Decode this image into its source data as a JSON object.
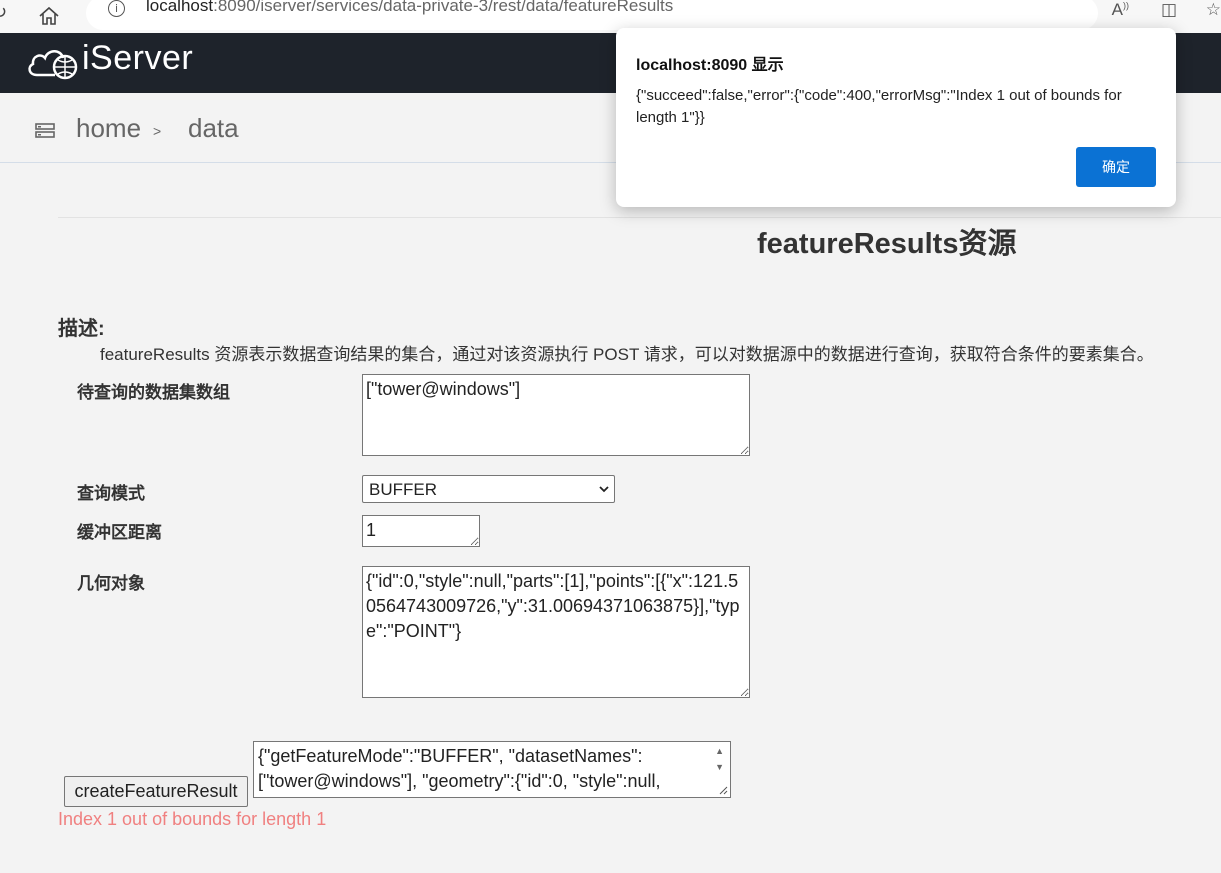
{
  "browser": {
    "url_host": "localhost",
    "url_rest": ":8090/iserver/services/data-private-3/rest/data/featureResults"
  },
  "header": {
    "logo_text": "iServer"
  },
  "breadcrumb": {
    "home": "home",
    "separator": ">",
    "current": "data"
  },
  "page": {
    "title": "featureResults资源",
    "desc_label": "描述:",
    "desc_text": "featureResults 资源表示数据查询结果的集合，通过对该资源执行 POST 请求，可以对数据源中的数据进行查询，获取符合条件的要素集合。"
  },
  "form": {
    "dataset_label": "待查询的数据集数组",
    "dataset_value": "[\"tower@windows\"]",
    "mode_label": "查询模式",
    "mode_value": "BUFFER",
    "buffer_label": "缓冲区距离",
    "buffer_value": "1",
    "geometry_label": "几何对象",
    "geometry_value": "{\"id\":0,\"style\":null,\"parts\":[1],\"points\":[{\"x\":121.50564743009726,\"y\":31.00694371063875}],\"type\":\"POINT\"}",
    "submit_label": "createFeatureResult",
    "request_body": "{\"getFeatureMode\":\"BUFFER\", \"datasetNames\":[\"tower@windows\"], \"geometry\":{\"id\":0, \"style\":null,",
    "error_text": "Index 1 out of bounds for length 1"
  },
  "dialog": {
    "title": "localhost:8090 显示",
    "message": "{\"succeed\":false,\"error\":{\"code\":400,\"errorMsg\":\"Index 1 out of bounds for length 1\"}}",
    "ok_label": "确定"
  }
}
